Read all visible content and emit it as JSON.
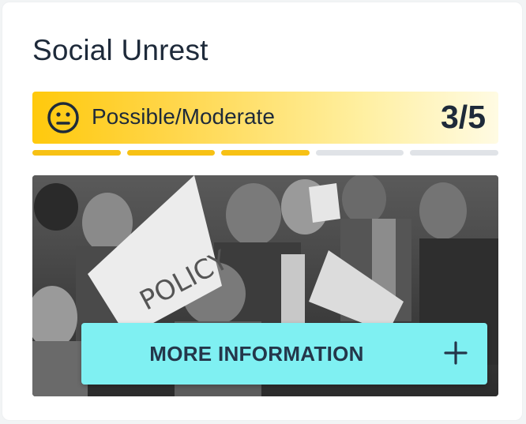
{
  "card": {
    "title": "Social Unrest"
  },
  "risk": {
    "icon": "neutral-face-icon",
    "label": "Possible/Moderate",
    "score": "3/5",
    "level": 3,
    "max_level": 5,
    "colors": {
      "accent": "#f7c115",
      "inactive": "#e0e3e7"
    }
  },
  "photo": {
    "sign_text": "POLICY"
  },
  "cta": {
    "label": "MORE INFORMATION",
    "icon": "plus-icon",
    "color": "#7ff0f2"
  }
}
